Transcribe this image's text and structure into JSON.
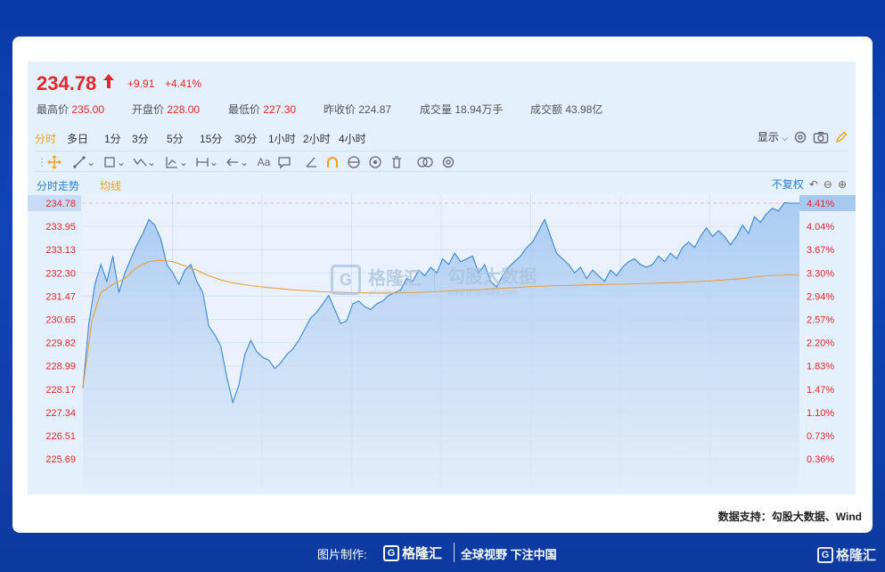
{
  "header": {
    "price": "234.78",
    "change": "+9.91",
    "change_pct": "+4.41%",
    "stats": [
      {
        "label": "最高价",
        "value": "235.00",
        "red": true
      },
      {
        "label": "开盘价",
        "value": "228.00",
        "red": true
      },
      {
        "label": "最低价",
        "value": "227.30",
        "red": true
      },
      {
        "label": "昨收价",
        "value": "224.87",
        "red": false
      },
      {
        "label": "成交量",
        "value": "18.94万手",
        "red": false
      },
      {
        "label": "成交额",
        "value": "43.98亿",
        "red": false
      }
    ]
  },
  "periods": [
    "分时",
    "多日",
    "1分",
    "3分",
    "5分",
    "15分",
    "30分",
    "1小时",
    "2小时",
    "4小时"
  ],
  "active_period": "分时",
  "display_label": "显示",
  "tabs": {
    "intraday": "分时走势",
    "avg": "均线"
  },
  "adjust_label": "不复权",
  "colors": {
    "up": "#e5262a",
    "line": "#3a86d8",
    "avg": "#e8a040",
    "accent": "#f0a020"
  },
  "chart_data": {
    "type": "area",
    "y_ticks_left": [
      "234.78",
      "233.95",
      "233.13",
      "232.30",
      "231.47",
      "230.65",
      "229.82",
      "228.99",
      "228.17",
      "227.34",
      "226.51",
      "225.69"
    ],
    "y_ticks_right": [
      "4.41%",
      "4.04%",
      "3.67%",
      "3.30%",
      "2.94%",
      "2.57%",
      "2.20%",
      "1.83%",
      "1.47%",
      "1.10%",
      "0.73%",
      "0.36%"
    ],
    "ylim": [
      224.87,
      234.78
    ],
    "n_points": 240,
    "price": [
      [
        0,
        228.2
      ],
      [
        2,
        230.5
      ],
      [
        4,
        231.9
      ],
      [
        6,
        232.6
      ],
      [
        8,
        232.0
      ],
      [
        10,
        232.9
      ],
      [
        12,
        231.6
      ],
      [
        14,
        232.3
      ],
      [
        16,
        232.8
      ],
      [
        18,
        233.3
      ],
      [
        20,
        233.7
      ],
      [
        22,
        234.2
      ],
      [
        24,
        234.0
      ],
      [
        26,
        233.5
      ],
      [
        28,
        232.6
      ],
      [
        30,
        232.3
      ],
      [
        32,
        231.9
      ],
      [
        34,
        232.4
      ],
      [
        36,
        232.6
      ],
      [
        38,
        232.0
      ],
      [
        40,
        231.6
      ],
      [
        42,
        230.4
      ],
      [
        44,
        230.1
      ],
      [
        46,
        229.7
      ],
      [
        48,
        228.6
      ],
      [
        50,
        227.7
      ],
      [
        52,
        228.3
      ],
      [
        54,
        229.4
      ],
      [
        56,
        229.9
      ],
      [
        58,
        229.5
      ],
      [
        60,
        229.3
      ],
      [
        62,
        229.2
      ],
      [
        64,
        228.9
      ],
      [
        66,
        229.1
      ],
      [
        68,
        229.4
      ],
      [
        70,
        229.6
      ],
      [
        72,
        229.9
      ],
      [
        74,
        230.3
      ],
      [
        76,
        230.7
      ],
      [
        78,
        230.9
      ],
      [
        80,
        231.2
      ],
      [
        82,
        231.5
      ],
      [
        84,
        231.0
      ],
      [
        86,
        230.5
      ],
      [
        88,
        230.6
      ],
      [
        90,
        231.2
      ],
      [
        92,
        231.3
      ],
      [
        94,
        231.1
      ],
      [
        96,
        231.0
      ],
      [
        98,
        231.2
      ],
      [
        100,
        231.3
      ],
      [
        102,
        231.5
      ],
      [
        104,
        231.6
      ],
      [
        106,
        231.7
      ],
      [
        108,
        232.1
      ],
      [
        110,
        232.0
      ],
      [
        112,
        232.4
      ],
      [
        114,
        232.2
      ],
      [
        116,
        232.5
      ],
      [
        118,
        232.3
      ],
      [
        120,
        232.8
      ],
      [
        122,
        232.6
      ],
      [
        124,
        233.0
      ],
      [
        126,
        232.7
      ],
      [
        128,
        232.8
      ],
      [
        130,
        232.9
      ],
      [
        132,
        232.3
      ],
      [
        134,
        232.6
      ],
      [
        136,
        232.0
      ],
      [
        138,
        231.8
      ],
      [
        140,
        232.2
      ],
      [
        142,
        232.5
      ],
      [
        144,
        232.7
      ],
      [
        146,
        232.9
      ],
      [
        148,
        233.2
      ],
      [
        150,
        233.4
      ],
      [
        152,
        233.8
      ],
      [
        154,
        234.2
      ],
      [
        156,
        233.6
      ],
      [
        158,
        233.0
      ],
      [
        160,
        232.8
      ],
      [
        162,
        232.6
      ],
      [
        164,
        232.3
      ],
      [
        166,
        232.5
      ],
      [
        168,
        232.1
      ],
      [
        170,
        232.4
      ],
      [
        172,
        232.2
      ],
      [
        174,
        232.0
      ],
      [
        176,
        232.4
      ],
      [
        178,
        232.2
      ],
      [
        180,
        232.5
      ],
      [
        182,
        232.7
      ],
      [
        184,
        232.8
      ],
      [
        186,
        232.6
      ],
      [
        188,
        232.5
      ],
      [
        190,
        232.6
      ],
      [
        192,
        232.9
      ],
      [
        194,
        232.7
      ],
      [
        196,
        233.0
      ],
      [
        198,
        232.8
      ],
      [
        200,
        233.2
      ],
      [
        202,
        233.4
      ],
      [
        204,
        233.2
      ],
      [
        206,
        233.6
      ],
      [
        208,
        233.9
      ],
      [
        210,
        233.6
      ],
      [
        212,
        233.8
      ],
      [
        214,
        233.6
      ],
      [
        216,
        233.3
      ],
      [
        218,
        233.6
      ],
      [
        220,
        234.0
      ],
      [
        222,
        233.7
      ],
      [
        224,
        234.3
      ],
      [
        226,
        234.1
      ],
      [
        228,
        234.4
      ],
      [
        230,
        234.6
      ],
      [
        232,
        234.5
      ],
      [
        234,
        234.8
      ],
      [
        236,
        234.78
      ],
      [
        239,
        234.78
      ]
    ],
    "avg_price": [
      [
        0,
        228.2
      ],
      [
        3,
        230.6
      ],
      [
        6,
        231.6
      ],
      [
        10,
        231.9
      ],
      [
        14,
        232.1
      ],
      [
        18,
        232.5
      ],
      [
        22,
        232.7
      ],
      [
        26,
        232.75
      ],
      [
        30,
        232.7
      ],
      [
        34,
        232.55
      ],
      [
        38,
        232.4
      ],
      [
        42,
        232.2
      ],
      [
        46,
        232.05
      ],
      [
        50,
        231.95
      ],
      [
        56,
        231.85
      ],
      [
        62,
        231.78
      ],
      [
        70,
        231.7
      ],
      [
        80,
        231.63
      ],
      [
        90,
        231.6
      ],
      [
        100,
        231.58
      ],
      [
        110,
        231.6
      ],
      [
        120,
        231.65
      ],
      [
        130,
        231.7
      ],
      [
        140,
        231.75
      ],
      [
        150,
        231.82
      ],
      [
        160,
        231.85
      ],
      [
        170,
        231.88
      ],
      [
        180,
        231.9
      ],
      [
        190,
        231.93
      ],
      [
        200,
        231.97
      ],
      [
        210,
        232.02
      ],
      [
        220,
        232.1
      ],
      [
        228,
        232.2
      ],
      [
        236,
        232.23
      ],
      [
        239,
        232.22
      ]
    ]
  },
  "watermark": {
    "brand": "格隆汇",
    "sub": "gelonghui.com",
    "brand2": "勾股大数据",
    "sub2": "www.gogudata.com"
  },
  "source": "数据支持：勾股大数据、Wind",
  "footer": {
    "made_by": "图片制作:",
    "brand": "格隆汇",
    "slogan": "全球视野 下注中国"
  }
}
